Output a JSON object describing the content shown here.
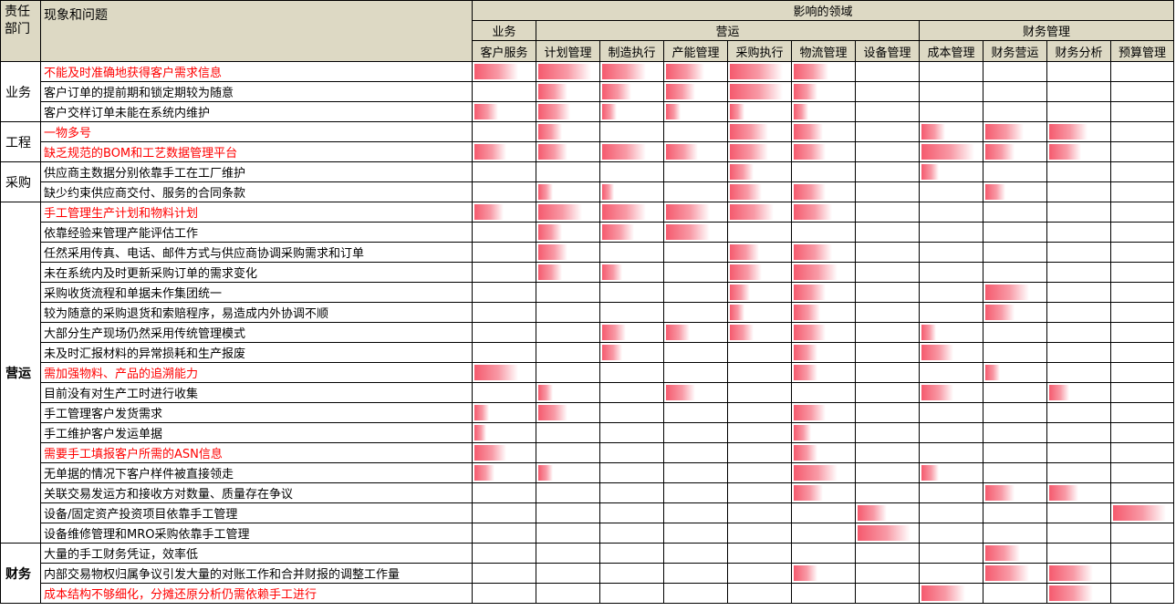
{
  "header": {
    "dept_label": "责任部门",
    "dept_line1": "责任",
    "dept_line2": "部门",
    "issue_label": "现象和问题",
    "area_label": "影响的领域",
    "groups": [
      {
        "label": "业务",
        "span": 1
      },
      {
        "label": "营运",
        "span": 6
      },
      {
        "label": "财务管理",
        "span": 4
      }
    ],
    "columns": [
      "客户服务",
      "计划管理",
      "制造执行",
      "产能管理",
      "采购执行",
      "物流管理",
      "设备管理",
      "成本管理",
      "财务营运",
      "财务分析",
      "预算管理"
    ]
  },
  "departments": [
    {
      "label": "业务",
      "rows": 3,
      "bold": false
    },
    {
      "label": "工程",
      "rows": 2,
      "bold": false
    },
    {
      "label": "采购",
      "rows": 2,
      "bold": false
    },
    {
      "label": "营运",
      "rows": 17,
      "bold": true
    },
    {
      "label": "财务",
      "rows": 3,
      "bold": true
    }
  ],
  "rows": [
    {
      "issue": "不能及时准确地获得客户需求信息",
      "red": true,
      "bars": [
        0.75,
        0.9,
        0.75,
        0.65,
        0.9,
        0.6,
        0,
        0,
        0,
        0,
        0
      ]
    },
    {
      "issue": "客户订单的提前期和锁定期较为随意",
      "red": false,
      "bars": [
        0,
        0.5,
        0.5,
        0.5,
        0.9,
        0.4,
        0,
        0,
        0,
        0,
        0
      ]
    },
    {
      "issue": "客户交样订单未能在系统内维护",
      "red": false,
      "bars": [
        0.4,
        0.55,
        0.25,
        0.25,
        0.25,
        0.25,
        0,
        0,
        0,
        0,
        0
      ]
    },
    {
      "issue": "一物多号",
      "red": true,
      "bars": [
        0,
        0.4,
        0,
        0,
        0.65,
        0.5,
        0,
        0.4,
        0.65,
        0.65,
        0
      ]
    },
    {
      "issue": "缺乏规范的BOM和工艺数据管理平台",
      "red": true,
      "bars": [
        0.55,
        0.5,
        0.75,
        0.55,
        0.65,
        0.55,
        0,
        0.9,
        0.5,
        0.55,
        0
      ]
    },
    {
      "issue": "供应商主数据分别依靠手工在工厂维护",
      "red": false,
      "bars": [
        0,
        0,
        0,
        0,
        0.4,
        0,
        0,
        0.3,
        0,
        0,
        0
      ]
    },
    {
      "issue": "缺少约束供应商交付、服务的合同条款",
      "red": false,
      "bars": [
        0,
        0.25,
        0.2,
        0,
        0.55,
        0.55,
        0,
        0,
        0.35,
        0,
        0
      ]
    },
    {
      "issue": "手工管理生产计划和物料计划",
      "red": true,
      "bars": [
        0.5,
        0.75,
        0.75,
        0.75,
        0.75,
        0.65,
        0,
        0,
        0,
        0,
        0
      ]
    },
    {
      "issue": "依靠经验来管理产能评估工作",
      "red": false,
      "bars": [
        0,
        0.4,
        0.55,
        0.75,
        0,
        0,
        0,
        0,
        0,
        0,
        0
      ]
    },
    {
      "issue": "任然采用传真、电话、邮件方式与供应商协调采购需求和订单",
      "red": false,
      "bars": [
        0,
        0.5,
        0,
        0,
        0.5,
        0.65,
        0,
        0,
        0,
        0,
        0
      ]
    },
    {
      "issue": "未在系统内及时更新采购订单的需求变化",
      "red": false,
      "bars": [
        0,
        0.4,
        0.35,
        0,
        0.55,
        0.75,
        0,
        0,
        0,
        0,
        0
      ]
    },
    {
      "issue": "采购收货流程和单据未作集团统一",
      "red": false,
      "bars": [
        0,
        0,
        0,
        0,
        0.35,
        0.55,
        0,
        0,
        0.75,
        0,
        0
      ]
    },
    {
      "issue": "较为随意的采购退货和索赔程序，易造成内外协调不顺",
      "red": false,
      "bars": [
        0,
        0,
        0,
        0,
        0.25,
        0.45,
        0,
        0,
        0.5,
        0,
        0
      ]
    },
    {
      "issue": "大部分生产现场仍然采用传统管理模式",
      "red": false,
      "bars": [
        0,
        0,
        0.4,
        0.4,
        0.4,
        0.55,
        0,
        0.25,
        0,
        0,
        0
      ]
    },
    {
      "issue": "未及时汇报材料的异常损耗和生产报废",
      "red": false,
      "bars": [
        0,
        0,
        0.35,
        0,
        0,
        0.4,
        0,
        0.55,
        0,
        0,
        0
      ]
    },
    {
      "issue": "需加强物料、产品的追溯能力",
      "red": true,
      "bars": [
        0.75,
        0,
        0,
        0,
        0,
        0.4,
        0,
        0,
        0.25,
        0,
        0
      ]
    },
    {
      "issue": "目前没有对生产工时进行收集",
      "red": false,
      "bars": [
        0,
        0.25,
        0,
        0.5,
        0,
        0,
        0,
        0.55,
        0,
        0.35,
        0
      ]
    },
    {
      "issue": "手工管理客户发货需求",
      "red": false,
      "bars": [
        0.25,
        0.5,
        0,
        0,
        0,
        0.55,
        0,
        0,
        0,
        0,
        0
      ]
    },
    {
      "issue": "手工维护客户发运单据",
      "red": false,
      "bars": [
        0.2,
        0,
        0,
        0,
        0,
        0.3,
        0,
        0,
        0,
        0,
        0
      ]
    },
    {
      "issue": "需要手工填报客户所需的ASN信息",
      "red": true,
      "bars": [
        0.55,
        0,
        0,
        0,
        0,
        0.4,
        0,
        0,
        0,
        0,
        0
      ]
    },
    {
      "issue": "无单据的情况下客户样件被直接领走",
      "red": false,
      "bars": [
        0.35,
        0.25,
        0,
        0,
        0,
        0.75,
        0,
        0.3,
        0,
        0,
        0
      ]
    },
    {
      "issue": "关联交易发运方和接收方对数量、质量存在争议",
      "red": false,
      "bars": [
        0,
        0,
        0,
        0,
        0,
        0.5,
        0,
        0,
        0.5,
        0.5,
        0
      ]
    },
    {
      "issue": "设备/固定资产投资项目依靠手工管理",
      "red": false,
      "bars": [
        0,
        0,
        0,
        0,
        0,
        0,
        0.5,
        0,
        0,
        0,
        0.9
      ]
    },
    {
      "issue": "设备维修管理和MRO采购依靠手工管理",
      "red": false,
      "bars": [
        0,
        0,
        0,
        0,
        0,
        0,
        0.9,
        0,
        0,
        0,
        0
      ]
    },
    {
      "issue": "大量的手工财务凭证，效率低",
      "red": false,
      "bars": [
        0,
        0,
        0,
        0,
        0,
        0,
        0,
        0,
        0.6,
        0,
        0
      ]
    },
    {
      "issue": "内部交易物权归属争议引发大量的对账工作和合并财报的调整工作量",
      "red": false,
      "bars": [
        0,
        0,
        0,
        0,
        0,
        0.4,
        0,
        0,
        0.75,
        0.75,
        0
      ]
    },
    {
      "issue": "成本结构不够细化，分摊还原分析仍需依赖手工进行",
      "red": true,
      "bars": [
        0,
        0,
        0,
        0,
        0,
        0,
        0,
        0.75,
        0,
        0.75,
        0
      ]
    }
  ]
}
